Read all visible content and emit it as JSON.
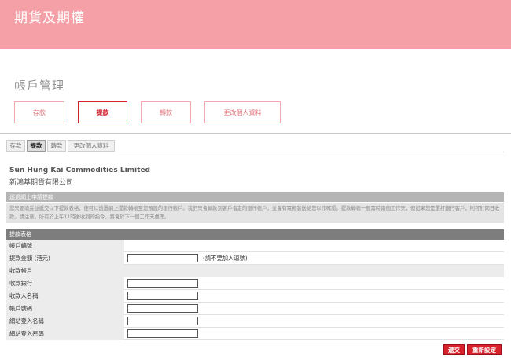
{
  "banner": {
    "title": "期貨及期權"
  },
  "section": {
    "title": "帳戶管理"
  },
  "tabs": [
    {
      "label": "存款"
    },
    {
      "label": "提款"
    },
    {
      "label": "轉款"
    },
    {
      "label": "更改個人資料"
    }
  ],
  "subtabs": [
    {
      "label": "存款"
    },
    {
      "label": "提款"
    },
    {
      "label": "轉款"
    },
    {
      "label": "更改個人資料"
    }
  ],
  "company": {
    "name_en": "Sun Hung Kai Commodities Limited",
    "name_zh": "新鴻基期貨有限公司"
  },
  "notice": {
    "heading": "透過網上申請提款",
    "text": "您只要填妥並遞交以下提款表格，便可以透過網上提款轉帳至您預設的銀行帳戶。我們只會轉款到客戶指定的銀行帳戶，並會有電郵發送給您以作確認。提款轉帳一般需時兩個工作天，但如果您是選打銀行客戶，則可於同日收款。請注意，所有於上午11時後收到的指令，將會於下一個工作天處理。"
  },
  "form": {
    "heading": "提款表格",
    "rows": [
      {
        "label": "帳戶編號",
        "section": false,
        "input": false,
        "note": ""
      },
      {
        "label": "提款金額 (港元)",
        "section": false,
        "input": true,
        "note": "(請不要加入逗號)"
      },
      {
        "label": "收款帳戶",
        "section": true,
        "input": false,
        "note": ""
      },
      {
        "label": "收款銀行",
        "section": false,
        "input": true,
        "note": ""
      },
      {
        "label": "收款人名稱",
        "section": false,
        "input": true,
        "note": ""
      },
      {
        "label": "帳戶號碼",
        "section": false,
        "input": true,
        "note": ""
      },
      {
        "label": "網站登入名稱",
        "section": false,
        "input": true,
        "note": ""
      },
      {
        "label": "網站登入密碼",
        "section": false,
        "input": true,
        "note": ""
      }
    ]
  },
  "buttons": {
    "submit": "遞交",
    "reset": "重新設定"
  }
}
